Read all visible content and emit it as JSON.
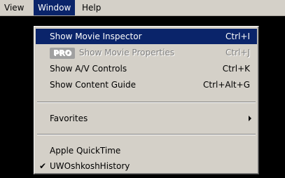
{
  "menubar": {
    "items": [
      "View",
      "Window",
      "Help"
    ]
  },
  "window_menu": {
    "items": [
      {
        "label": "Show Movie Inspector",
        "shortcut": "Ctrl+I"
      },
      {
        "badge": "PRO",
        "label": "Show Movie Properties",
        "shortcut": "Ctrl+J"
      },
      {
        "label": "Show A/V Controls",
        "shortcut": "Ctrl+K"
      },
      {
        "label": "Show Content Guide",
        "shortcut": "Ctrl+Alt+G"
      },
      {
        "label": "Favorites"
      },
      {
        "label": "Apple QuickTime"
      },
      {
        "label": "UWOshkoshHistory",
        "check": "✔"
      }
    ]
  }
}
